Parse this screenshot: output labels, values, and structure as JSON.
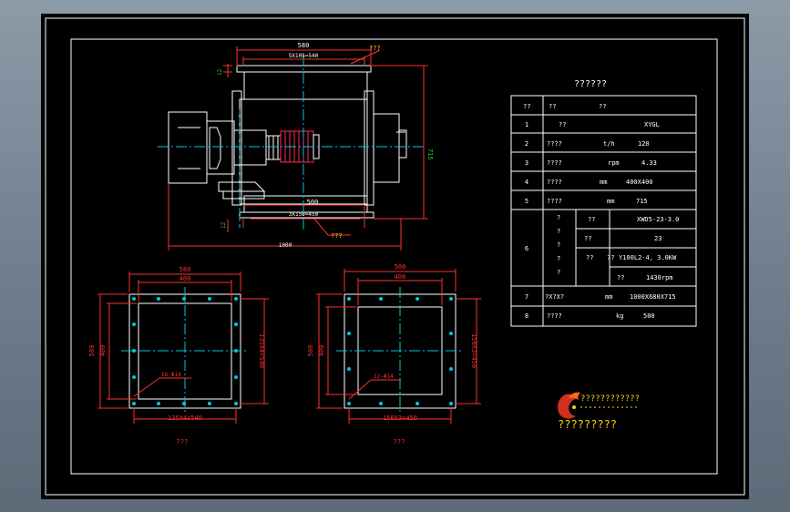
{
  "drawing": {
    "top_view": {
      "dim_top_width": "580",
      "dim_top_bolts": "5X105=540",
      "dim_top_callout": "???",
      "dim_left_height": "12",
      "dim_right_height": "715",
      "dim_bottom_width": "500",
      "dim_bottom_bolts": "3X150=450",
      "dim_bottom_callout": "???",
      "dim_bottom_offset": "12",
      "dim_overall_length": "1000"
    },
    "flange_left": {
      "dim_outer": "580",
      "dim_inner": "400",
      "dim_height_outer": "580",
      "dim_height_inner": "400",
      "dim_right": "135X4=540",
      "dim_bottom": "135X4=540",
      "hole_label": "16-Φ14",
      "caption": "???"
    },
    "flange_right": {
      "dim_outer": "500",
      "dim_inner": "400",
      "dim_height_outer": "500",
      "dim_height_inner": "400",
      "dim_right": "150X3=450",
      "dim_bottom": "150X3=450",
      "hole_label": "12-Φ14",
      "caption": "???"
    }
  },
  "spec_table": {
    "title": "??????",
    "header": [
      "??",
      "??",
      "??"
    ],
    "rows": [
      {
        "no": "1",
        "name": "??",
        "unit": "",
        "value": "XYGL"
      },
      {
        "no": "2",
        "name": "????",
        "unit": "t/h",
        "value": "120"
      },
      {
        "no": "3",
        "name": "????",
        "unit": "rpm",
        "value": "4.33"
      },
      {
        "no": "4",
        "name": "????",
        "unit": "mm",
        "value": "400X400"
      },
      {
        "no": "5",
        "name": "????",
        "unit": "mm",
        "value": "715"
      },
      {
        "no": "6",
        "name": "?\n?\n?\n?\n?",
        "unit": "",
        "value": "",
        "sub": [
          {
            "name": "??",
            "unit": "",
            "value": "XWD5-23-3.0"
          },
          {
            "name": "??",
            "unit": "",
            "value": "23"
          },
          {
            "name": "??",
            "unit": "??",
            "value": "Y100L2-4, 3.0KW"
          },
          {
            "name": "",
            "unit": "??",
            "value": "1430rpm"
          }
        ]
      },
      {
        "no": "7",
        "name": "?X?X?",
        "unit": "mm",
        "value": "1000X680X715"
      },
      {
        "no": "8",
        "name": "????",
        "unit": "kg",
        "value": "500"
      }
    ]
  },
  "logo": {
    "company_line1": "????????????",
    "company_line2": "?????????"
  },
  "colors": {
    "background": "#000000",
    "outline": "#ffffff",
    "dimension": "#ff3030",
    "centerline": "#00c8d8",
    "motor": "#ff2a5a",
    "text_accent": "#ffd400",
    "green": "#22d022"
  }
}
